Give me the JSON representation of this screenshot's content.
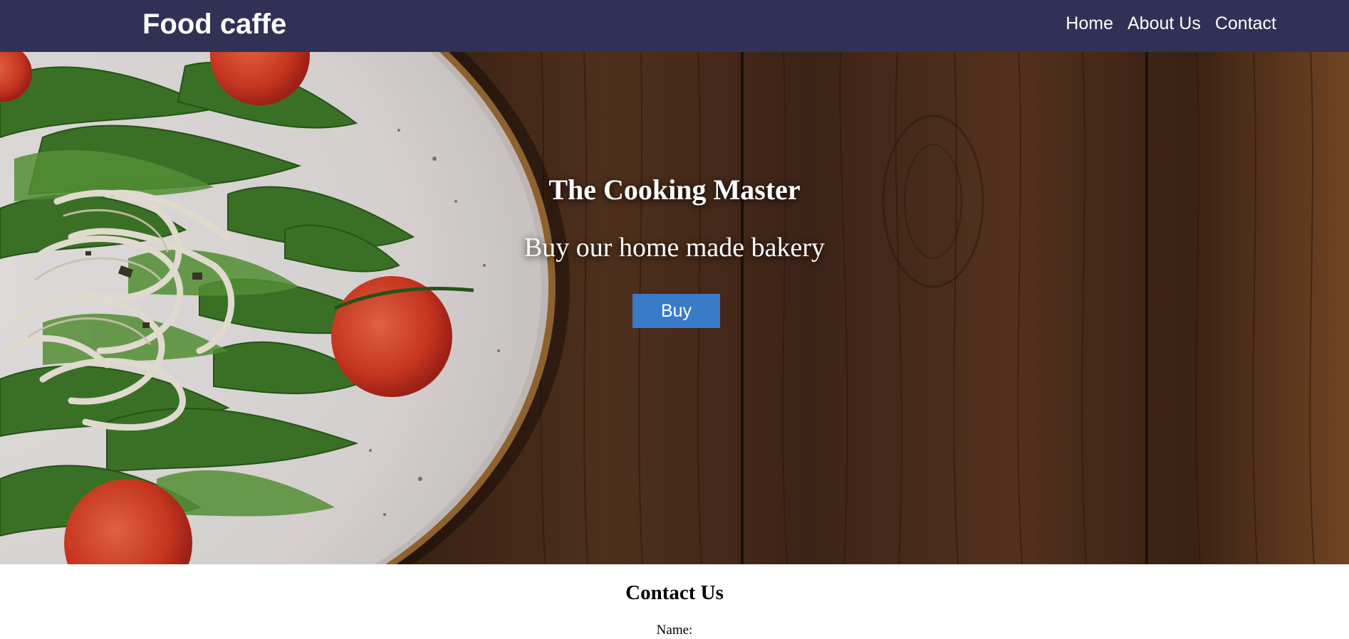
{
  "navbar": {
    "brand": "Food caffe",
    "links": [
      {
        "label": "Home"
      },
      {
        "label": "About Us"
      },
      {
        "label": "Contact"
      }
    ],
    "background": "#313055"
  },
  "hero": {
    "title": "The Cooking Master",
    "subtitle": "Buy our home made bakery",
    "button_label": "Buy",
    "button_color": "#3a7bc8"
  },
  "contact": {
    "title": "Contact Us",
    "name_label": "Name:"
  }
}
